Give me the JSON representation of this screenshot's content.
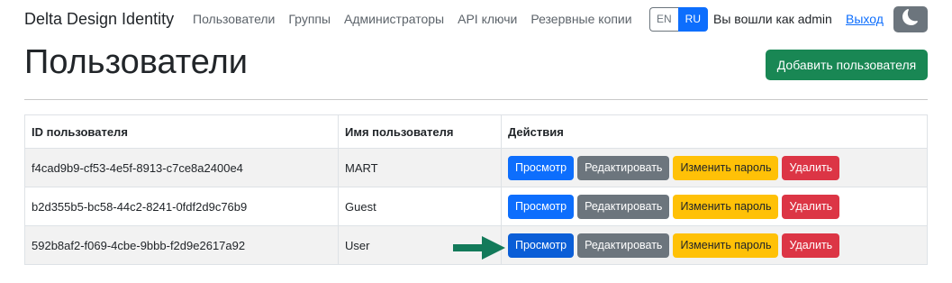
{
  "brand": "Delta Design Identity",
  "nav": {
    "links": [
      "Пользователи",
      "Группы",
      "Администраторы",
      "API ключи",
      "Резервные копии"
    ],
    "lang": {
      "en": "EN",
      "ru": "RU",
      "active": "RU"
    },
    "logged_in": "Вы вошли как admin",
    "logout": "Выход",
    "theme_icon": "moon-icon"
  },
  "page": {
    "title": "Пользователи",
    "add_user": "Добавить пользователя"
  },
  "table": {
    "headers": [
      "ID пользователя",
      "Имя пользователя",
      "Действия"
    ],
    "actions": {
      "view": "Просмотр",
      "edit": "Редактировать",
      "change_password": "Изменить пароль",
      "delete": "Удалить"
    },
    "rows": [
      {
        "id": "f4cad9b9-cf53-4e5f-8913-c7ce8a2400e4",
        "name": "MART"
      },
      {
        "id": "b2d355b5-bc58-44c2-8241-0fdf2d9c76b9",
        "name": "Guest"
      },
      {
        "id": "592b8af2-f069-4cbe-9bbb-f2d9e2617a92",
        "name": "User"
      }
    ]
  },
  "colors": {
    "primary": "#0d6efd",
    "success": "#198754",
    "secondary": "#6c757d",
    "warning": "#ffc107",
    "danger": "#dc3545",
    "arrow": "#137a5a"
  }
}
